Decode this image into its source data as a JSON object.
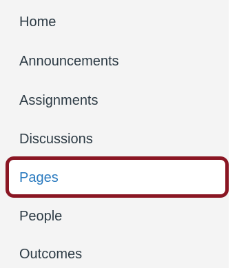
{
  "course_nav": {
    "items": [
      {
        "label": "Home"
      },
      {
        "label": "Announcements"
      },
      {
        "label": "Assignments"
      },
      {
        "label": "Discussions"
      },
      {
        "label": "Pages",
        "active": true
      },
      {
        "label": "People"
      },
      {
        "label": "Outcomes"
      }
    ]
  },
  "colors": {
    "nav_background": "#f4f4f4",
    "text": "#2d3b45",
    "active_link": "#2a7abf",
    "highlight_border": "#8a1623"
  }
}
